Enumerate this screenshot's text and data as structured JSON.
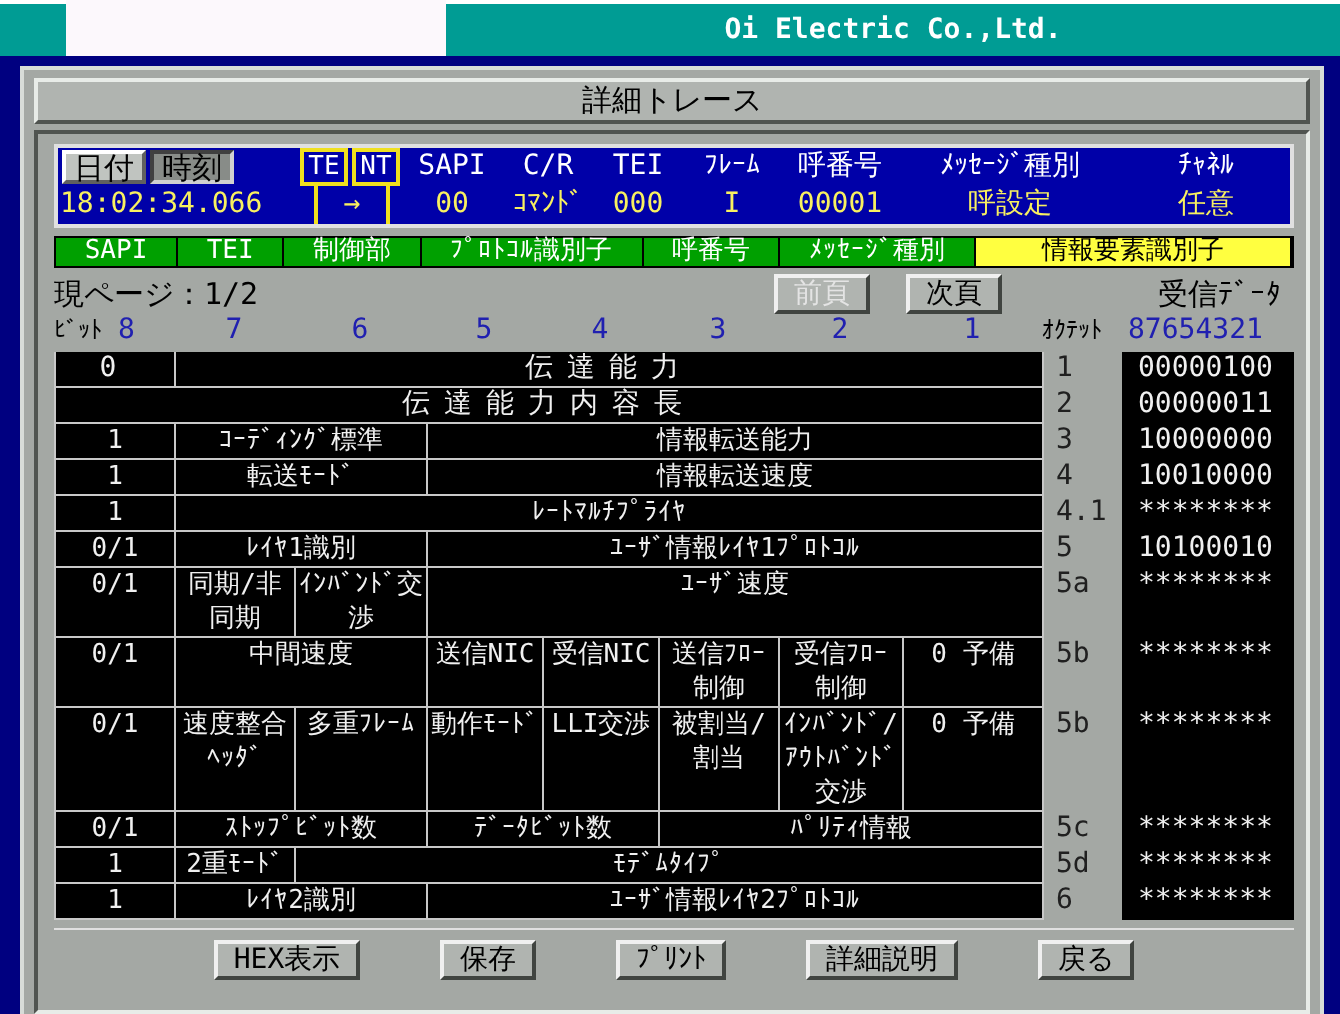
{
  "company": "Oi Electric Co.,Ltd.",
  "window": {
    "title": "詳細トレース"
  },
  "header": {
    "tabs": [
      {
        "label": "日付",
        "selected": false
      },
      {
        "label": "時刻",
        "selected": true
      }
    ],
    "columns": [
      "TE",
      "NT",
      "SAPI",
      "C/R",
      "TEI",
      "ﾌﾚｰﾑ",
      "呼番号",
      "ﾒｯｾｰｼﾞ種別",
      "ﾁｬﾈﾙ"
    ],
    "values": [
      "18:02:34.066",
      "→",
      "00",
      "ｺﾏﾝﾄﾞ",
      "000",
      "I",
      "00001",
      "呼設定",
      "任意"
    ]
  },
  "field_tabs": [
    {
      "label": "SAPI",
      "selected": false
    },
    {
      "label": "TEI",
      "selected": false
    },
    {
      "label": "制御部",
      "selected": false
    },
    {
      "label": "ﾌﾟﾛﾄｺﾙ識別子",
      "selected": false
    },
    {
      "label": "呼番号",
      "selected": false
    },
    {
      "label": "ﾒｯｾｰｼﾞ種別",
      "selected": false
    },
    {
      "label": "情報要素識別子",
      "selected": true
    }
  ],
  "page": "現ページ：1/2",
  "nav_buttons": [
    {
      "label": "前頁",
      "disabled": true
    },
    {
      "label": "次頁",
      "disabled": false
    }
  ],
  "received_label": "受信ﾃﾞｰﾀ",
  "bit_label": "ﾋﾞｯﾄ",
  "bits": [
    "8",
    "7",
    "6",
    "5",
    "4",
    "3",
    "2",
    "1"
  ],
  "octet_label": "ｵｸﾃｯﾄ",
  "data_bits": "87654321",
  "rows": [
    {
      "cells": [
        "0",
        "伝達能力"
      ],
      "octet": "1",
      "data": "00000100"
    },
    {
      "cells": [
        "伝達能力内容長"
      ],
      "octet": "2",
      "data": "00000011"
    },
    {
      "cells": [
        "1",
        "ｺｰﾃﾞｨﾝｸﾞ標準",
        "情報転送能力"
      ],
      "octet": "3",
      "data": "10000000"
    },
    {
      "cells": [
        "1",
        "転送ﾓｰﾄﾞ",
        "情報転送速度"
      ],
      "octet": "4",
      "data": "10010000"
    },
    {
      "cells": [
        "1",
        "ﾚｰﾄﾏﾙﾁﾌﾟﾗｲﾔ"
      ],
      "octet": "4.1",
      "data": "********"
    },
    {
      "cells": [
        "0/1",
        "ﾚｲﾔ1識別",
        "ﾕｰｻﾞ情報ﾚｲﾔ1ﾌﾟﾛﾄｺﾙ"
      ],
      "octet": "5",
      "data": "10100010"
    },
    {
      "cells": [
        "0/1",
        "同期/非同期",
        "ｲﾝﾊﾞﾝﾄﾞ交渉",
        "ﾕｰｻﾞ速度"
      ],
      "octet": "5a",
      "data": "********"
    },
    {
      "cells": [
        "0/1",
        "中間速度",
        "送信NIC",
        "受信NIC",
        "送信ﾌﾛｰ制御",
        "受信ﾌﾛｰ制御",
        "0 予備"
      ],
      "octet": "5b",
      "data": "********"
    },
    {
      "cells": [
        "0/1",
        "速度整合ﾍｯﾀﾞ",
        "多重ﾌﾚｰﾑ",
        "動作ﾓｰﾄﾞ",
        "LLI交渉",
        "被割当/割当",
        "ｲﾝﾊﾞﾝﾄﾞ/ｱｳﾄﾊﾞﾝﾄﾞ交渉",
        "0 予備"
      ],
      "octet": "5b",
      "data": "********"
    },
    {
      "cells": [
        "0/1",
        "ｽﾄｯﾌﾟﾋﾞｯﾄ数",
        "ﾃﾞｰﾀﾋﾞｯﾄ数",
        "ﾊﾟﾘﾃｨ情報"
      ],
      "octet": "5c",
      "data": "********"
    },
    {
      "cells": [
        "1",
        "2重ﾓｰﾄﾞ",
        "ﾓﾃﾞﾑﾀｲﾌﾟ"
      ],
      "octet": "5d",
      "data": "********"
    },
    {
      "cells": [
        "1",
        "ﾚｲﾔ2識別",
        "ﾕｰｻﾞ情報ﾚｲﾔ2ﾌﾟﾛﾄｺﾙ"
      ],
      "octet": "6",
      "data": "********"
    }
  ],
  "footer_buttons": [
    "HEX表示",
    "保存",
    "ﾌﾟﾘﾝﾄ",
    "詳細説明",
    "戻る"
  ]
}
